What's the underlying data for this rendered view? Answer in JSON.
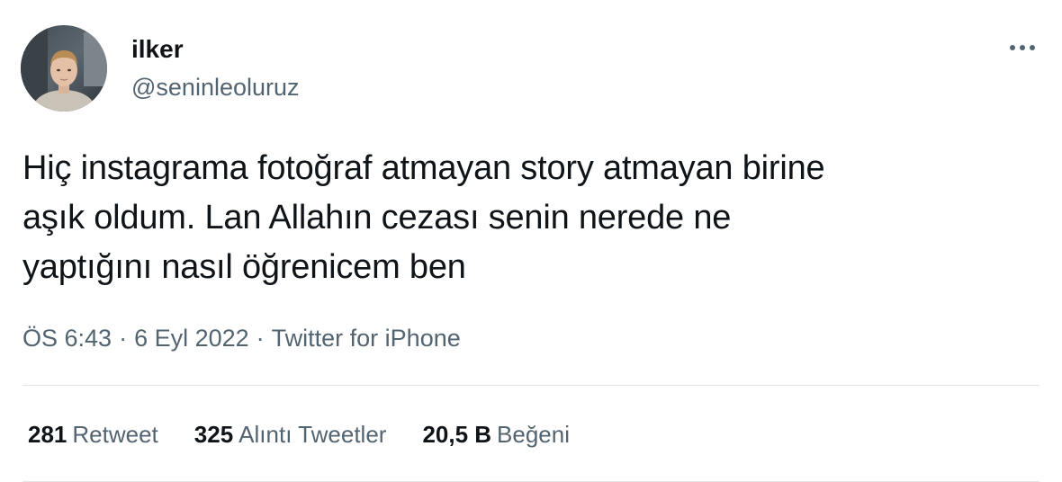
{
  "user": {
    "display_name": "ilker",
    "handle": "@seninleoluruz"
  },
  "tweet": {
    "lines": [
      "Hiç instagrama fotoğraf atmayan story atmayan birine",
      "aşık oldum. Lan Allahın cezası senin nerede ne",
      "yaptığını nasıl öğrenicem ben"
    ]
  },
  "meta": {
    "time": "ÖS 6:43",
    "separator": "·",
    "date": "6 Eyl 2022",
    "source": "Twitter for iPhone"
  },
  "stats": [
    {
      "count": "281",
      "label": "Retweet"
    },
    {
      "count": "325",
      "label": "Alıntı Tweetler"
    },
    {
      "count": "20,5 B",
      "label": "Beğeni"
    }
  ],
  "icons": {
    "more": "more-horizontal-icon"
  },
  "colors": {
    "text_primary": "#0f1419",
    "text_secondary": "#536471",
    "divider": "#e1e6ea"
  }
}
